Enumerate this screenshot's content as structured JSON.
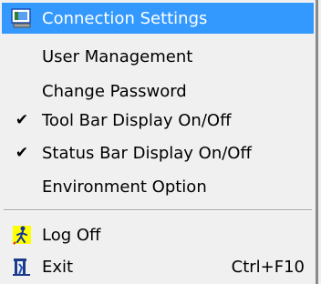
{
  "menu": {
    "items": [
      {
        "label": "Connection Settings",
        "icon": "connection-settings-icon",
        "highlighted": true
      },
      {
        "label": "User Management"
      },
      {
        "label": "Change Password"
      },
      {
        "label": "Tool Bar Display On/Off",
        "checked": true
      },
      {
        "label": "Status Bar Display On/Off",
        "checked": true
      },
      {
        "label": "Environment Option"
      },
      {
        "label": "Log Off",
        "icon": "log-off-icon"
      },
      {
        "label": "Exit",
        "icon": "exit-icon",
        "shortcut": "Ctrl+F10"
      }
    ],
    "check_glyph": "✔"
  },
  "colors": {
    "highlight": "#3399ff",
    "menu_background": "#f0f0f0"
  }
}
